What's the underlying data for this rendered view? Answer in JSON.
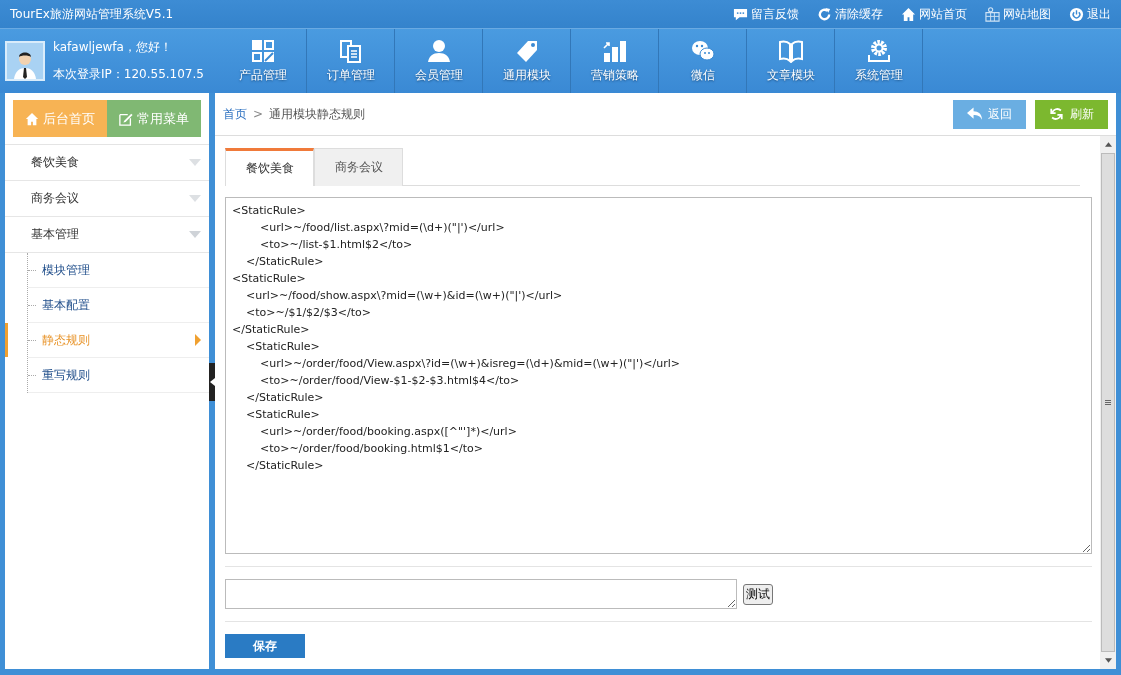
{
  "app_title": "TourEx旅游网站管理系统V5.1",
  "top_links": [
    {
      "label": "留言反馈"
    },
    {
      "label": "清除缓存"
    },
    {
      "label": "网站首页"
    },
    {
      "label": "网站地图"
    },
    {
      "label": "退出"
    }
  ],
  "user": {
    "greeting": "kafawljewfa，您好！",
    "login_ip": "本次登录IP：120.55.107.5"
  },
  "nav": [
    {
      "label": "产品管理"
    },
    {
      "label": "订单管理"
    },
    {
      "label": "会员管理"
    },
    {
      "label": "通用模块"
    },
    {
      "label": "营销策略"
    },
    {
      "label": "微信"
    },
    {
      "label": "文章模块"
    },
    {
      "label": "系统管理"
    }
  ],
  "sidebar": {
    "home_button": "后台首页",
    "menu_button": "常用菜单",
    "groups": [
      {
        "label": "餐饮美食",
        "expanded": false
      },
      {
        "label": "商务会议",
        "expanded": false
      },
      {
        "label": "基本管理",
        "expanded": true,
        "children": [
          {
            "label": "模块管理",
            "selected": false
          },
          {
            "label": "基本配置",
            "selected": false
          },
          {
            "label": "静态规则",
            "selected": true
          },
          {
            "label": "重写规则",
            "selected": false
          }
        ]
      }
    ]
  },
  "breadcrumb": {
    "home": "首页",
    "separator": ">",
    "current": "通用模块静态规则"
  },
  "actions": {
    "back": "返回",
    "refresh": "刷新"
  },
  "tabs": [
    {
      "label": "餐饮美食",
      "selected": true
    },
    {
      "label": "商务会议",
      "selected": false
    }
  ],
  "editor": {
    "value": "<StaticRule>\n\t\t<url>~/food/list.aspx\\?mid=(\\d+)(\"|')</url>\n\t\t<to>~/list-$1.html$2</to>\n\t</StaticRule>\n<StaticRule>\n\t<url>~/food/show.aspx\\?mid=(\\w+)&id=(\\w+)(\"|')</url>\n\t<to>~/$1/$2/$3</to>\n</StaticRule>\n\t<StaticRule>\n\t\t<url>~/order/food/View.aspx\\?id=(\\w+)&isreg=(\\d+)&mid=(\\w+)(\"|')</url>\n\t\t<to>~/order/food/View-$1-$2-$3.html$4</to>\n\t</StaticRule>\n\t<StaticRule>\n\t\t<url>~/order/food/booking.aspx([^\"']*)</url>\n\t\t<to>~/order/food/booking.html$1</to>\n\t</StaticRule>"
  },
  "test_button": "测试",
  "save_button": "保存"
}
